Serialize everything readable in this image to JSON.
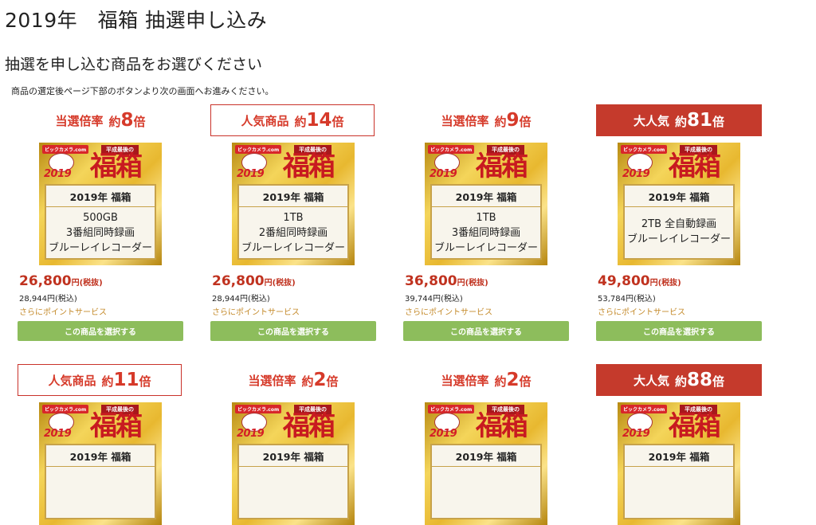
{
  "page": {
    "title": "2019年　福箱 抽選申し込み",
    "subtitle": "抽選を申し込む商品をお選びください",
    "note": "商品の選定後ページ下部のボタンより次の画面へお進みください。"
  },
  "thumbnail_common": {
    "logo": "ビックカメラ.com",
    "ribbon": "平成最後の",
    "year": "2019",
    "fukubako": "福箱"
  },
  "products": [
    {
      "badge_lead": "当選倍率",
      "badge_num": "約8倍",
      "head": "2019年 福箱",
      "lines": [
        "500GB",
        "3番組同時録画",
        "ブルーレイレコーダー"
      ],
      "price": "26,800",
      "price_unit": "円(税抜)",
      "tax_in": "28,944円(税込)",
      "points": "さらにポイントサービス",
      "button": "この商品を選択する"
    },
    {
      "badge_lead": "人気商品",
      "badge_num": "約14倍",
      "head": "2019年 福箱",
      "lines": [
        "1TB",
        "2番組同時録画",
        "ブルーレイレコーダー"
      ],
      "price": "26,800",
      "price_unit": "円(税抜)",
      "tax_in": "28,944円(税込)",
      "points": "さらにポイントサービス",
      "button": "この商品を選択する"
    },
    {
      "badge_lead": "当選倍率",
      "badge_num": "約9倍",
      "head": "2019年 福箱",
      "lines": [
        "1TB",
        "3番組同時録画",
        "ブルーレイレコーダー"
      ],
      "price": "36,800",
      "price_unit": "円(税抜)",
      "tax_in": "39,744円(税込)",
      "points": "さらにポイントサービス",
      "button": "この商品を選択する"
    },
    {
      "badge_lead": "大人気",
      "badge_num": "約81倍",
      "head": "2019年 福箱",
      "lines": [
        "2TB 全自動録画",
        "ブルーレイレコーダー",
        ""
      ],
      "price": "49,800",
      "price_unit": "円(税抜)",
      "tax_in": "53,784円(税込)",
      "points": "さらにポイントサービス",
      "button": "この商品を選択する"
    },
    {
      "badge_lead": "人気商品",
      "badge_num": "約11倍",
      "head": "2019年 福箱"
    },
    {
      "badge_lead": "当選倍率",
      "badge_num": "約2倍",
      "head": "2019年 福箱"
    },
    {
      "badge_lead": "当選倍率",
      "badge_num": "約2倍",
      "head": "2019年 福箱"
    },
    {
      "badge_lead": "大人気",
      "badge_num": "約88倍",
      "head": "2019年 福箱"
    }
  ]
}
